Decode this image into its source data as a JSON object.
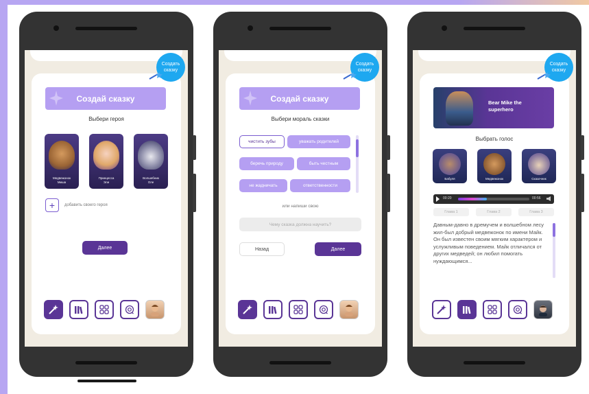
{
  "fab": {
    "label_line1": "Создать",
    "label_line2": "сказку"
  },
  "screen1": {
    "title": "Создай сказку",
    "subtitle": "Выбери героя",
    "heroes": [
      {
        "line1": "Медвежонок",
        "line2": "Миша"
      },
      {
        "line1": "Принцесса",
        "line2": "Эли"
      },
      {
        "line1": "Волшебник",
        "line2": "Оле"
      }
    ],
    "add_hero_label": "добавить своего героя",
    "next_label": "Далее"
  },
  "screen2": {
    "title": "Создай сказку",
    "subtitle": "Выбери мораль сказки",
    "morals": [
      "чистить зубы",
      "уважать родителей",
      "беречь природу",
      "быть честным",
      "не жадничать",
      "ответственности"
    ],
    "or_write_label": "или напиши свою",
    "input_placeholder": "Чему сказка должна научить?",
    "back_label": "Назад",
    "next_label": "Далее",
    "moral_scroll_position": 0.1
  },
  "screen3": {
    "story_title_line1": "Bear Mike the",
    "story_title_line2": "superhero",
    "voice_label": "Выбрать голос",
    "voices": [
      "Бабуля",
      "Медвежонок",
      "Сказочник"
    ],
    "player": {
      "elapsed": "00:20",
      "total": "00:56",
      "progress": 0.4
    },
    "chapters": [
      "Глава 1",
      "Глава 2",
      "Глава 3"
    ],
    "story_text": "Давным-давно в дремучем и волшебном лесу жил-был добрый медвежонок по имени Майк. Он был известен своим мягким характером и услужливым поведением. Майк отличался от других медведей; он любил помогать нуждающимся..."
  },
  "icons": [
    "magic-wand-icon",
    "library-icon",
    "grid-icon",
    "chat-icon",
    "profile-avatar"
  ]
}
